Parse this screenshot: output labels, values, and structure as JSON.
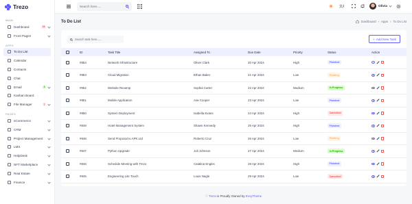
{
  "app": {
    "logo_text": "Trezo",
    "brand_color": "#605dff"
  },
  "sidebar": {
    "sections": [
      {
        "title": "MAIN",
        "items": [
          {
            "label": "Dashboard",
            "icon": "dashboard-icon",
            "badge": "16",
            "badge_color": "#ff4a4a",
            "badge_bg": "#ffe8e8",
            "chevron": true
          },
          {
            "label": "Front Pages",
            "icon": "front-pages-icon",
            "chevron": true
          }
        ]
      },
      {
        "title": "APPS",
        "items": [
          {
            "label": "To Do List",
            "icon": "todo-icon",
            "active": true
          },
          {
            "label": "Calendar",
            "icon": "calendar-icon"
          },
          {
            "label": "Contacts",
            "icon": "contacts-icon"
          },
          {
            "label": "Chat",
            "icon": "chat-icon"
          },
          {
            "label": "Email",
            "icon": "email-icon",
            "badge": "3",
            "badge_color": "#25b003",
            "badge_bg": "#d8ffc8",
            "chevron": true
          },
          {
            "label": "Kanban Board",
            "icon": "kanban-icon"
          },
          {
            "label": "File Manager",
            "icon": "file-manager-icon",
            "badge": "7",
            "badge_color": "#ff4a4a",
            "badge_bg": "#ffe8e8",
            "chevron": true
          }
        ]
      },
      {
        "title": "PAGES",
        "items": [
          {
            "label": "eCommerce",
            "icon": "ecommerce-icon",
            "chevron": true
          },
          {
            "label": "CRM",
            "icon": "crm-icon",
            "chevron": true
          },
          {
            "label": "Project Management",
            "icon": "project-icon",
            "chevron": true
          },
          {
            "label": "LMS",
            "icon": "lms-icon",
            "chevron": true
          },
          {
            "label": "HelpDesk",
            "icon": "helpdesk-icon",
            "chevron": true
          },
          {
            "label": "NFT Marketplace",
            "icon": "nft-icon",
            "chevron": true
          },
          {
            "label": "Real Estate",
            "icon": "real-estate-icon",
            "chevron": true
          },
          {
            "label": "Finance",
            "icon": "finance-icon",
            "chevron": true
          }
        ]
      }
    ]
  },
  "topbar": {
    "search_placeholder": "Search here.....",
    "user_name": "Olivia"
  },
  "page": {
    "title": "To Do List",
    "breadcrumbs": [
      "Dashboard",
      "Apps",
      "To Do List"
    ]
  },
  "toolbar": {
    "task_search_placeholder": "Search task here.....",
    "add_label": "Add New Task"
  },
  "table": {
    "columns": [
      "ID",
      "Task Title",
      "Assigned To",
      "Due Date",
      "Priority",
      "Status",
      "Action"
    ],
    "rows": [
      {
        "id": "#854",
        "title": "Network Infrastructure",
        "assigned": "Oliver Clark",
        "due": "20 Apr 2024",
        "priority": "High",
        "status": "Finished"
      },
      {
        "id": "#853",
        "title": "Cloud Migration",
        "assigned": "Ethan Baker",
        "due": "21 Apr 2024",
        "priority": "Low",
        "status": "Pending"
      },
      {
        "id": "#852",
        "title": "Website Revamp",
        "assigned": "Sophia Carter",
        "due": "22 Apr 2024",
        "priority": "Medium",
        "status": "In Progress"
      },
      {
        "id": "#851",
        "title": "Mobile Application",
        "assigned": "Ava Cooper",
        "due": "23 Apr 2024",
        "priority": "Low",
        "status": "Finished"
      },
      {
        "id": "#850",
        "title": "System Deployment",
        "assigned": "Isabella Evans",
        "due": "24 Apr 2024",
        "priority": "High",
        "status": "Cancelled"
      },
      {
        "id": "#849",
        "title": "Hotel Management System",
        "assigned": "Shawn Kennedy",
        "due": "25 Apr 2024",
        "priority": "High",
        "status": "Finished"
      },
      {
        "id": "#848",
        "title": "Send Proposal to APK Ltd",
        "assigned": "Roberto Cruz",
        "due": "26 Apr 2024",
        "priority": "Low",
        "status": "Pending"
      },
      {
        "id": "#847",
        "title": "Python Upgrade",
        "assigned": "Juli Johnson",
        "due": "27 Apr 2024",
        "priority": "Medium",
        "status": "In Progress"
      },
      {
        "id": "#846",
        "title": "Schedule Meeting with Trezo",
        "assigned": "Catalina Engles",
        "due": "28 Apr 2024",
        "priority": "High",
        "status": "Finished"
      },
      {
        "id": "#845",
        "title": "Engineering Lite Touch",
        "assigned": "Louis Nagle",
        "due": "29 Apr 2024",
        "priority": "Low",
        "status": "Cancelled"
      }
    ]
  },
  "status_colors": {
    "Finished": {
      "color": "#605dff",
      "bg": "#ecf0ff"
    },
    "Pending": {
      "color": "#ffb264",
      "bg": "#fff4e6"
    },
    "In Progress": {
      "color": "#25b003",
      "bg": "#d8ffc8"
    },
    "Cancelled": {
      "color": "#ff4a4a",
      "bg": "#ffe8e8"
    }
  },
  "footer": {
    "brand": "Trezo",
    "text": " is Proudly Owned by ",
    "owner": "EnvyTheme"
  }
}
